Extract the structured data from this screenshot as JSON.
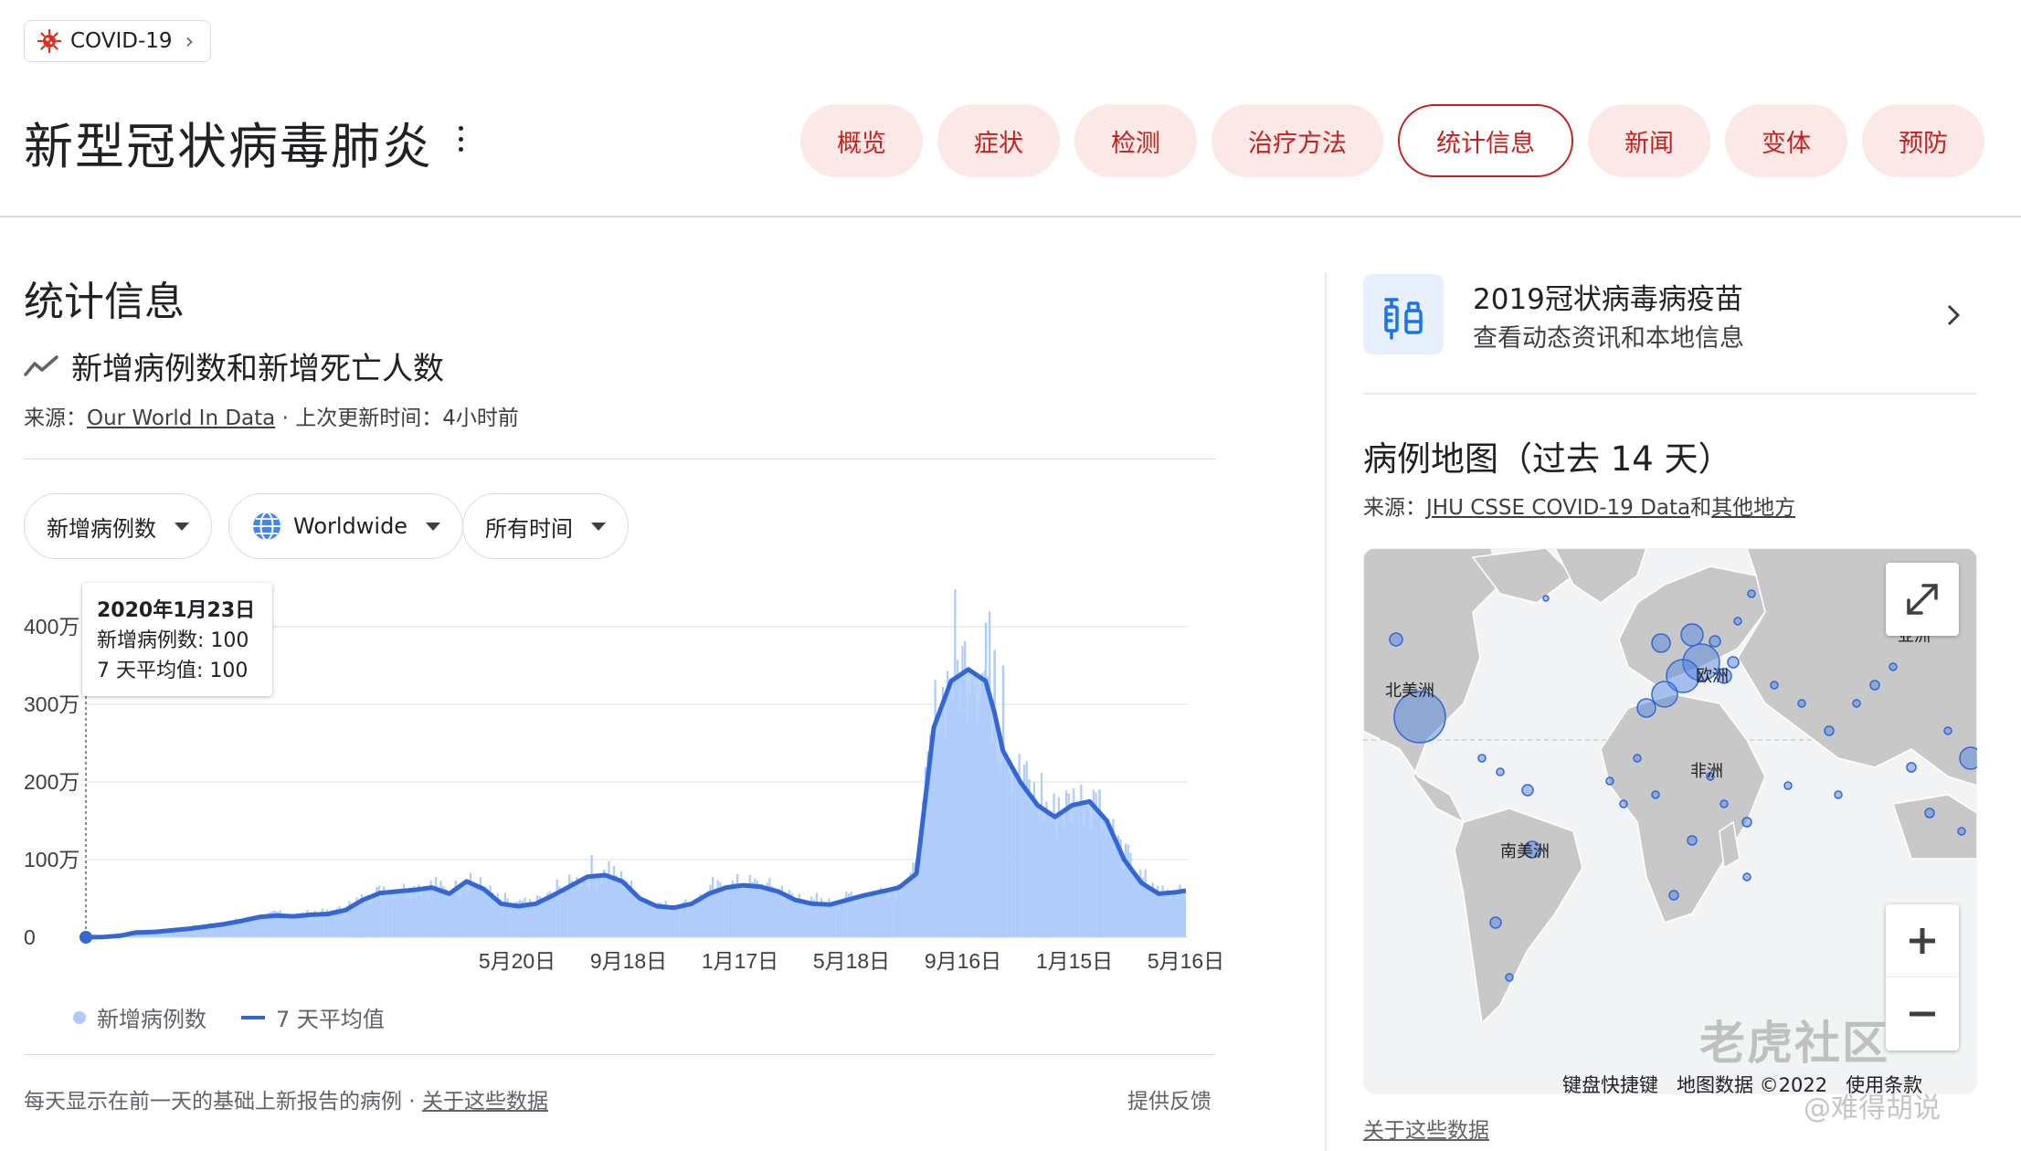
{
  "topic_chip": {
    "label": "COVID-19"
  },
  "page_title": "新型冠状病毒肺炎",
  "tabs": [
    {
      "label": "概览",
      "active": false
    },
    {
      "label": "症状",
      "active": false
    },
    {
      "label": "检测",
      "active": false
    },
    {
      "label": "治疗方法",
      "active": false
    },
    {
      "label": "统计信息",
      "active": true
    },
    {
      "label": "新闻",
      "active": false
    },
    {
      "label": "变体",
      "active": false
    },
    {
      "label": "预防",
      "active": false
    }
  ],
  "stats": {
    "section_title": "统计信息",
    "chart_title": "新增病例数和新增死亡人数",
    "source_prefix": "来源：",
    "source_link": "Our World In Data",
    "updated": " · 上次更新时间：4小时前",
    "filters": {
      "metric": "新增病例数",
      "region": "Worldwide",
      "period": "所有时间"
    },
    "tooltip": {
      "date": "2020年1月23日",
      "cases": "新增病例数: 100",
      "avg": "7 天平均值: 100"
    },
    "legend": {
      "cases": "新增病例数",
      "avg": "7 天平均值"
    },
    "footnote": "每天显示在前一天的基础上新报告的病例",
    "footnote_sep": " · ",
    "footnote_link": "关于这些数据",
    "feedback": "提供反馈"
  },
  "chart_data": {
    "type": "area",
    "x_ticks": [
      "5月20日",
      "9月18日",
      "1月17日",
      "5月18日",
      "9月16日",
      "1月15日",
      "5月16日"
    ],
    "y_ticks": [
      "400万",
      "300万",
      "200万",
      "100万",
      "0"
    ],
    "ylim": [
      0,
      4000000
    ],
    "grid": true,
    "colors": {
      "bars": "#aecbfa",
      "line": "#3367d6"
    },
    "series": [
      {
        "name": "7 天平均值",
        "x": [
          0,
          14,
          28,
          40,
          56,
          70,
          84,
          98,
          112,
          126,
          140,
          154,
          168,
          182,
          196,
          210,
          224,
          238,
          252,
          266,
          280,
          294,
          308,
          322,
          336,
          350,
          364,
          378,
          392,
          406,
          420,
          434,
          448,
          462,
          476,
          490,
          504,
          518,
          532,
          546,
          560,
          574,
          588,
          602,
          616,
          630,
          644,
          658,
          672,
          686,
          700,
          714,
          728,
          735,
          742,
          756,
          770,
          784,
          798,
          812,
          826,
          840,
          854,
          868,
          882,
          890
        ],
        "values": [
          100,
          2000,
          20000,
          60000,
          70000,
          90000,
          110000,
          140000,
          170000,
          210000,
          260000,
          280000,
          270000,
          290000,
          300000,
          350000,
          480000,
          570000,
          590000,
          610000,
          640000,
          560000,
          720000,
          620000,
          430000,
          400000,
          430000,
          540000,
          660000,
          780000,
          800000,
          720000,
          500000,
          400000,
          380000,
          430000,
          560000,
          640000,
          670000,
          650000,
          590000,
          480000,
          430000,
          420000,
          480000,
          540000,
          590000,
          640000,
          820000,
          2700000,
          3300000,
          3450000,
          3300000,
          2900000,
          2400000,
          2000000,
          1700000,
          1550000,
          1700000,
          1750000,
          1500000,
          1000000,
          700000,
          560000,
          580000,
          600000
        ],
        "x_unit": "days since 2020-01-23"
      }
    ]
  },
  "vaccine": {
    "title": "2019冠状病毒病疫苗",
    "subtitle": "查看动态资讯和本地信息"
  },
  "map": {
    "title": "病例地图（过去 14 天）",
    "source_prefix": "来源：",
    "source_link": "JHU CSSE COVID-19 Data",
    "source_mid": "和",
    "source_link2": "其他地方",
    "labels": {
      "na": "北美洲",
      "eu": "欧洲",
      "af": "非洲",
      "sa": "南美洲",
      "asia": "亚洲"
    },
    "attribution": [
      "键盘快捷键",
      "地图数据 ©2022",
      "使用条款"
    ],
    "about": "关于这些数据",
    "watermark": "老虎社区",
    "watermark_user": "@难得胡说"
  }
}
